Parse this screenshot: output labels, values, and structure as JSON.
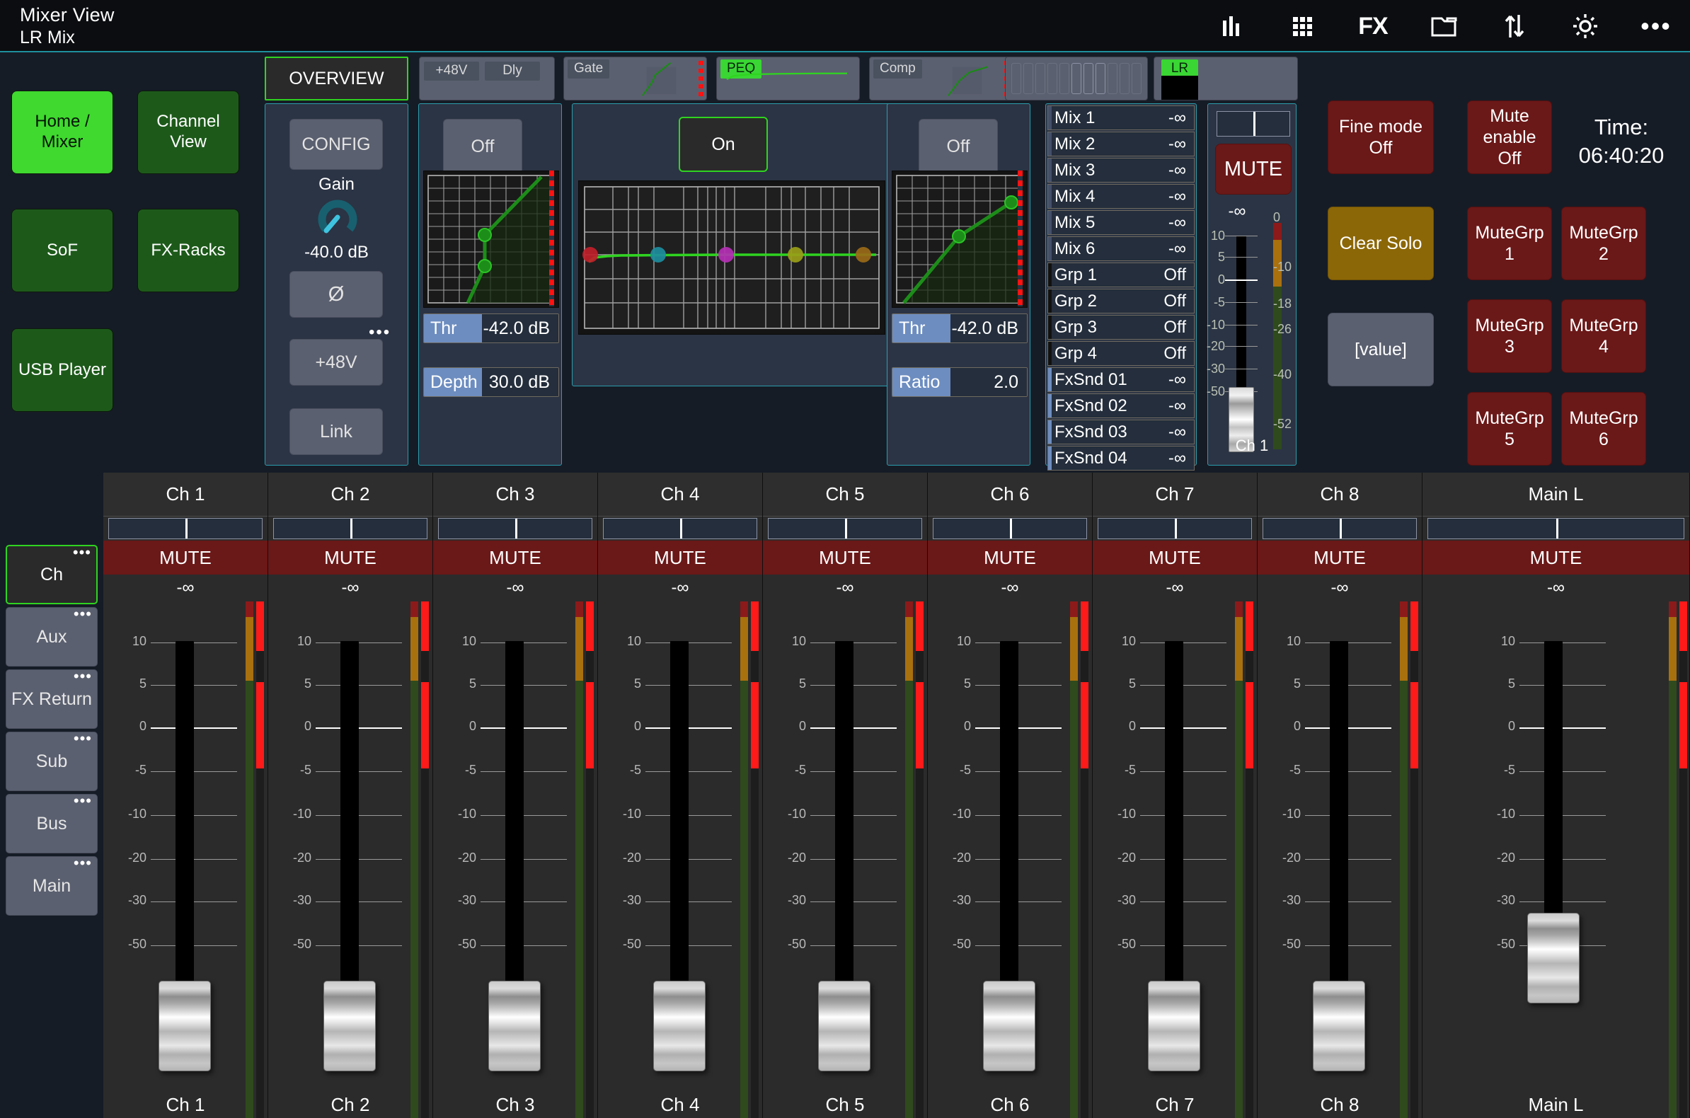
{
  "topbar": {
    "title": "Mixer View",
    "subtitle": "LR Mix",
    "icons": [
      {
        "name": "meters-icon",
        "glyph": "bars"
      },
      {
        "name": "grid-icon",
        "glyph": "grid"
      },
      {
        "name": "fx-icon",
        "glyph": "FX"
      },
      {
        "name": "folder-icon",
        "glyph": "folder"
      },
      {
        "name": "transfer-icon",
        "glyph": "updown"
      },
      {
        "name": "gear-icon",
        "glyph": "gear"
      },
      {
        "name": "more-icon",
        "glyph": "dots"
      }
    ]
  },
  "nav": {
    "buttons": [
      {
        "label": "Home / Mixer",
        "active": true
      },
      {
        "label": "Channel View",
        "active": false
      },
      {
        "label": "SoF",
        "active": false
      },
      {
        "label": "FX-Racks",
        "active": false
      },
      {
        "label": "USB Player",
        "active": false
      }
    ]
  },
  "proc_tabs": {
    "overview": "OVERVIEW",
    "preamp": {
      "btn1": "+48V",
      "btn2": "Dly"
    },
    "gate": "Gate",
    "peq": "PEQ",
    "comp": "Comp",
    "lr": "LR"
  },
  "config_panel": {
    "config_label": "CONFIG",
    "gain_label": "Gain",
    "gain_value": "-40.0 dB",
    "phase_label": "Ø",
    "phantom_label": "+48V",
    "link_label": "Link"
  },
  "gate_panel": {
    "state": "Off",
    "thr_label": "Thr",
    "thr_value": "-42.0 dB",
    "depth_label": "Depth",
    "depth_value": "30.0 dB"
  },
  "peq_panel": {
    "state": "On"
  },
  "comp_panel": {
    "state": "Off",
    "thr_label": "Thr",
    "thr_value": "-42.0 dB",
    "ratio_label": "Ratio",
    "ratio_value": "2.0"
  },
  "sends": [
    {
      "name": "Mix 1",
      "value": "-∞",
      "tick": "#44506a"
    },
    {
      "name": "Mix 2",
      "value": "-∞",
      "tick": "#44506a"
    },
    {
      "name": "Mix 3",
      "value": "-∞",
      "tick": "#44506a"
    },
    {
      "name": "Mix 4",
      "value": "-∞",
      "tick": "#44506a"
    },
    {
      "name": "Mix 5",
      "value": "-∞",
      "tick": "#44506a"
    },
    {
      "name": "Mix 6",
      "value": "-∞",
      "tick": "#44506a"
    },
    {
      "name": "Grp 1",
      "value": "Off",
      "tick": "#111111"
    },
    {
      "name": "Grp 2",
      "value": "Off",
      "tick": "#111111"
    },
    {
      "name": "Grp 3",
      "value": "Off",
      "tick": "#111111"
    },
    {
      "name": "Grp 4",
      "value": "Off",
      "tick": "#111111"
    },
    {
      "name": "FxSnd 01",
      "value": "-∞",
      "tick": "#6d8dc0"
    },
    {
      "name": "FxSnd 02",
      "value": "-∞",
      "tick": "#6d8dc0"
    },
    {
      "name": "FxSnd 03",
      "value": "-∞",
      "tick": "#6d8dc0"
    },
    {
      "name": "FxSnd 04",
      "value": "-∞",
      "tick": "#6d8dc0"
    }
  ],
  "selected_channel": {
    "mute_label": "MUTE",
    "level": "-∞",
    "name": "Ch 1",
    "fader_ticks": [
      "10",
      "5",
      "0",
      "-5",
      "-10",
      "-20",
      "-30",
      "-50"
    ],
    "meter_ticks": [
      "0",
      "-10",
      "-18",
      "-26",
      "-40",
      "-52"
    ]
  },
  "right_controls": {
    "fine_mode": "Fine mode\nOff",
    "mute_enable": "Mute\nenable\nOff",
    "time_label": "Time:",
    "time_value": "06:40:20",
    "clear_solo": "Clear Solo",
    "value_btn": "[value]",
    "mute_groups": [
      "MuteGrp 1",
      "MuteGrp 2",
      "MuteGrp 3",
      "MuteGrp 4",
      "MuteGrp 5",
      "MuteGrp 6"
    ]
  },
  "bank_selector": [
    {
      "label": "Ch",
      "selected": true
    },
    {
      "label": "Aux",
      "selected": false
    },
    {
      "label": "FX Return",
      "selected": false
    },
    {
      "label": "Sub",
      "selected": false
    },
    {
      "label": "Bus",
      "selected": false
    },
    {
      "label": "Main",
      "selected": false
    }
  ],
  "strip_scale": {
    "ticks": [
      "10",
      "5",
      "0",
      "-5",
      "-10",
      "-20",
      "-30",
      "-50"
    ]
  },
  "channels": [
    {
      "name": "Ch 1",
      "mute": "MUTE",
      "level": "-∞",
      "fader_pos": 0.78
    },
    {
      "name": "Ch 2",
      "mute": "MUTE",
      "level": "-∞",
      "fader_pos": 0.78
    },
    {
      "name": "Ch 3",
      "mute": "MUTE",
      "level": "-∞",
      "fader_pos": 0.78
    },
    {
      "name": "Ch 4",
      "mute": "MUTE",
      "level": "-∞",
      "fader_pos": 0.78
    },
    {
      "name": "Ch 5",
      "mute": "MUTE",
      "level": "-∞",
      "fader_pos": 0.78
    },
    {
      "name": "Ch 6",
      "mute": "MUTE",
      "level": "-∞",
      "fader_pos": 0.78
    },
    {
      "name": "Ch 7",
      "mute": "MUTE",
      "level": "-∞",
      "fader_pos": 0.78
    },
    {
      "name": "Ch 8",
      "mute": "MUTE",
      "level": "-∞",
      "fader_pos": 0.78
    }
  ],
  "main_strip": {
    "name": "Main L",
    "mute": "MUTE",
    "level": "-∞",
    "link_icon": "link-icon",
    "fader_pos": 0.78
  },
  "colors": {
    "accent_cyan": "#2c9dae",
    "accent_green": "#2fd420",
    "mute_red": "#6b1818",
    "gold": "#8c6707",
    "panel_bg": "#2b3444",
    "button_grey": "#5b6070"
  }
}
